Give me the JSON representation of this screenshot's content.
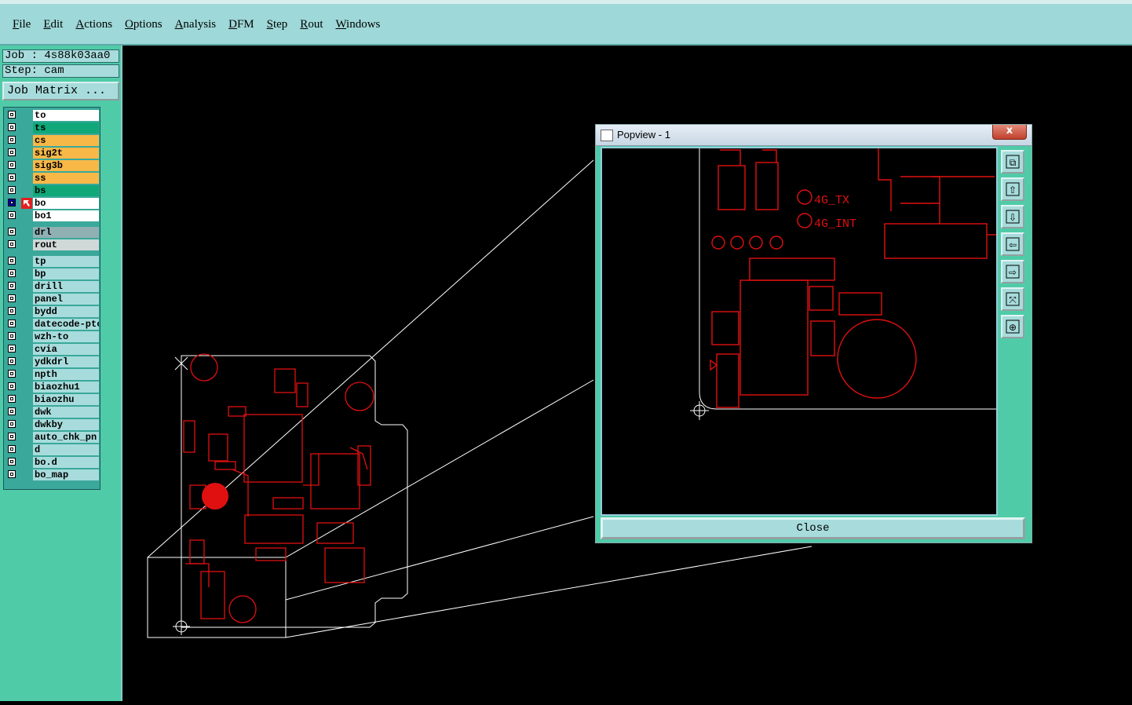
{
  "menu": [
    "File",
    "Edit",
    "Actions",
    "Options",
    "Analysis",
    "DFM",
    "Step",
    "Rout",
    "Windows"
  ],
  "job": {
    "label": "Job : 4s88k03aa0",
    "step": "Step: cam",
    "matrix_button": "Job Matrix ..."
  },
  "layers_board": [
    {
      "name": "to",
      "color": "#ffffff"
    },
    {
      "name": "ts",
      "color": "#10a878"
    },
    {
      "name": "cs",
      "color": "#f8b848"
    },
    {
      "name": "sig2t",
      "color": "#f8b848"
    },
    {
      "name": "sig3b",
      "color": "#f8b848"
    },
    {
      "name": "ss",
      "color": "#f8b848"
    },
    {
      "name": "bs",
      "color": "#10a878"
    },
    {
      "name": "bo",
      "color": "#ffffff"
    },
    {
      "name": "bo1",
      "color": "#ffffff"
    }
  ],
  "layers_drill": [
    {
      "name": "drl",
      "color": "#90b0b4"
    },
    {
      "name": "rout",
      "color": "#d0d8d8"
    }
  ],
  "layers_misc": [
    {
      "name": "tp"
    },
    {
      "name": "bp"
    },
    {
      "name": "drill"
    },
    {
      "name": "panel"
    },
    {
      "name": "bydd"
    },
    {
      "name": "datecode-ptc"
    },
    {
      "name": "wzh-to"
    },
    {
      "name": "cvia"
    },
    {
      "name": "ydkdrl"
    },
    {
      "name": "npth"
    },
    {
      "name": "biaozhu1"
    },
    {
      "name": "biaozhu"
    },
    {
      "name": "dwk"
    },
    {
      "name": "dwkby"
    },
    {
      "name": "auto_chk_pn"
    },
    {
      "name": "d"
    },
    {
      "name": "bo.d"
    },
    {
      "name": "bo_map"
    }
  ],
  "popview": {
    "title": "Popview - 1",
    "close_label": "Close",
    "close_x": "x",
    "labels": [
      "4G_TX",
      "4G_INT"
    ],
    "tools": [
      "zoom-fit-icon",
      "pan-up-icon",
      "pan-down-icon",
      "pan-left-icon",
      "pan-right-icon",
      "zoom-home-icon",
      "zoom-out-icon"
    ]
  },
  "colors": {
    "menubar": "#9fd8d8",
    "panel": "#50cba8",
    "trace": "#e01010"
  }
}
